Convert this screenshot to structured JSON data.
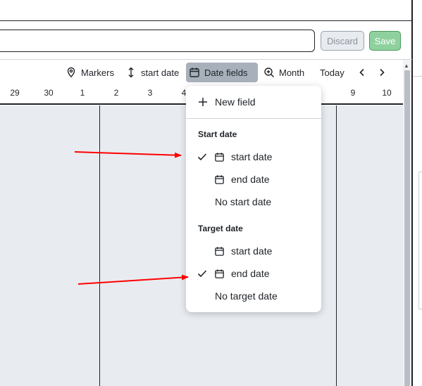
{
  "header": {
    "discard_label": "Discard",
    "save_label": "Save"
  },
  "toolbar": {
    "markers_label": "Markers",
    "sort_label": "start date",
    "date_fields_label": "Date fields",
    "zoom_label": "Month",
    "today_label": "Today"
  },
  "timeline": {
    "days": [
      "29",
      "30",
      "1",
      "2",
      "3",
      "4",
      "9",
      "10"
    ]
  },
  "date_fields_menu": {
    "new_field_label": "New field",
    "start_heading": "Start date",
    "start_options": [
      {
        "label": "start date",
        "checked": true
      },
      {
        "label": "end date",
        "checked": false
      }
    ],
    "no_start_label": "No start date",
    "target_heading": "Target date",
    "target_options": [
      {
        "label": "start date",
        "checked": false
      },
      {
        "label": "end date",
        "checked": true
      }
    ],
    "no_target_label": "No target date"
  },
  "colors": {
    "save_button": "#8fd19e",
    "grid_background": "#e8ecf0",
    "annotation_arrow": "#ff0000",
    "active_tool": "#a8b0bb"
  }
}
